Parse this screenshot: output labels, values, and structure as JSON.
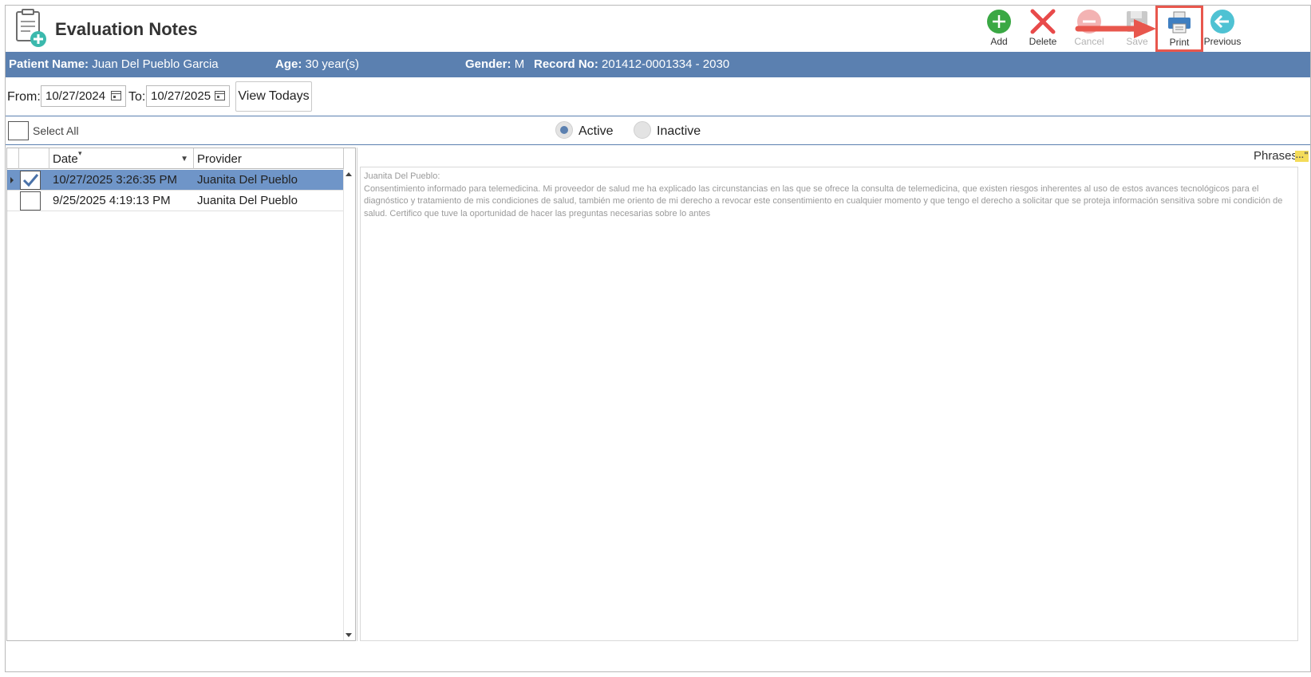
{
  "header": {
    "title": "Evaluation Notes",
    "toolbar": {
      "add": "Add",
      "delete": "Delete",
      "cancel": "Cancel",
      "save": "Save",
      "print": "Print",
      "previous": "Previous"
    }
  },
  "patient": {
    "name_label": "Patient Name:",
    "name": "Juan Del Pueblo Garcia",
    "age_label": "Age:",
    "age": "30 year(s)",
    "gender_label": "Gender:",
    "gender": "M",
    "record_label": "Record No:",
    "record": "201412-0001334 - 2030"
  },
  "filter": {
    "from_label": "From:",
    "from_value": "10/27/2024",
    "to_label": "To:",
    "to_value": "10/27/2025",
    "view_todays": "View Todays"
  },
  "selection": {
    "select_all": "Select All",
    "active": "Active",
    "inactive": "Inactive",
    "active_selected": true
  },
  "grid": {
    "columns": [
      "Date",
      "Provider"
    ],
    "rows": [
      {
        "date": "10/27/2025 3:26:35 PM",
        "provider": "Juanita Del Pueblo",
        "checked": true,
        "selected": true
      },
      {
        "date": "9/25/2025 4:19:13 PM",
        "provider": "Juanita Del Pueblo",
        "checked": false,
        "selected": false
      }
    ]
  },
  "notes": {
    "phrases_label": "Phrases",
    "author": "Juanita Del Pueblo:",
    "body": "Consentimiento informado para telemedicina. Mi proveedor de salud me ha explicado las circunstancias en las que se ofrece la consulta de telemedicina, que existen riesgos inherentes al uso de estos avances tecnológicos para el diagnóstico y tratamiento de mis condiciones de salud, también me oriento de mi derecho a revocar este consentimiento en cualquier momento y que tengo el derecho a solicitar que se proteja información sensitiva sobre mi condición de salud. Certifico que tuve la oportunidad de hacer las preguntas necesarias sobre lo antes"
  },
  "colors": {
    "header_bar": "#5b80b0",
    "selected_row": "#6f95c8",
    "highlight": "#e8574d"
  }
}
